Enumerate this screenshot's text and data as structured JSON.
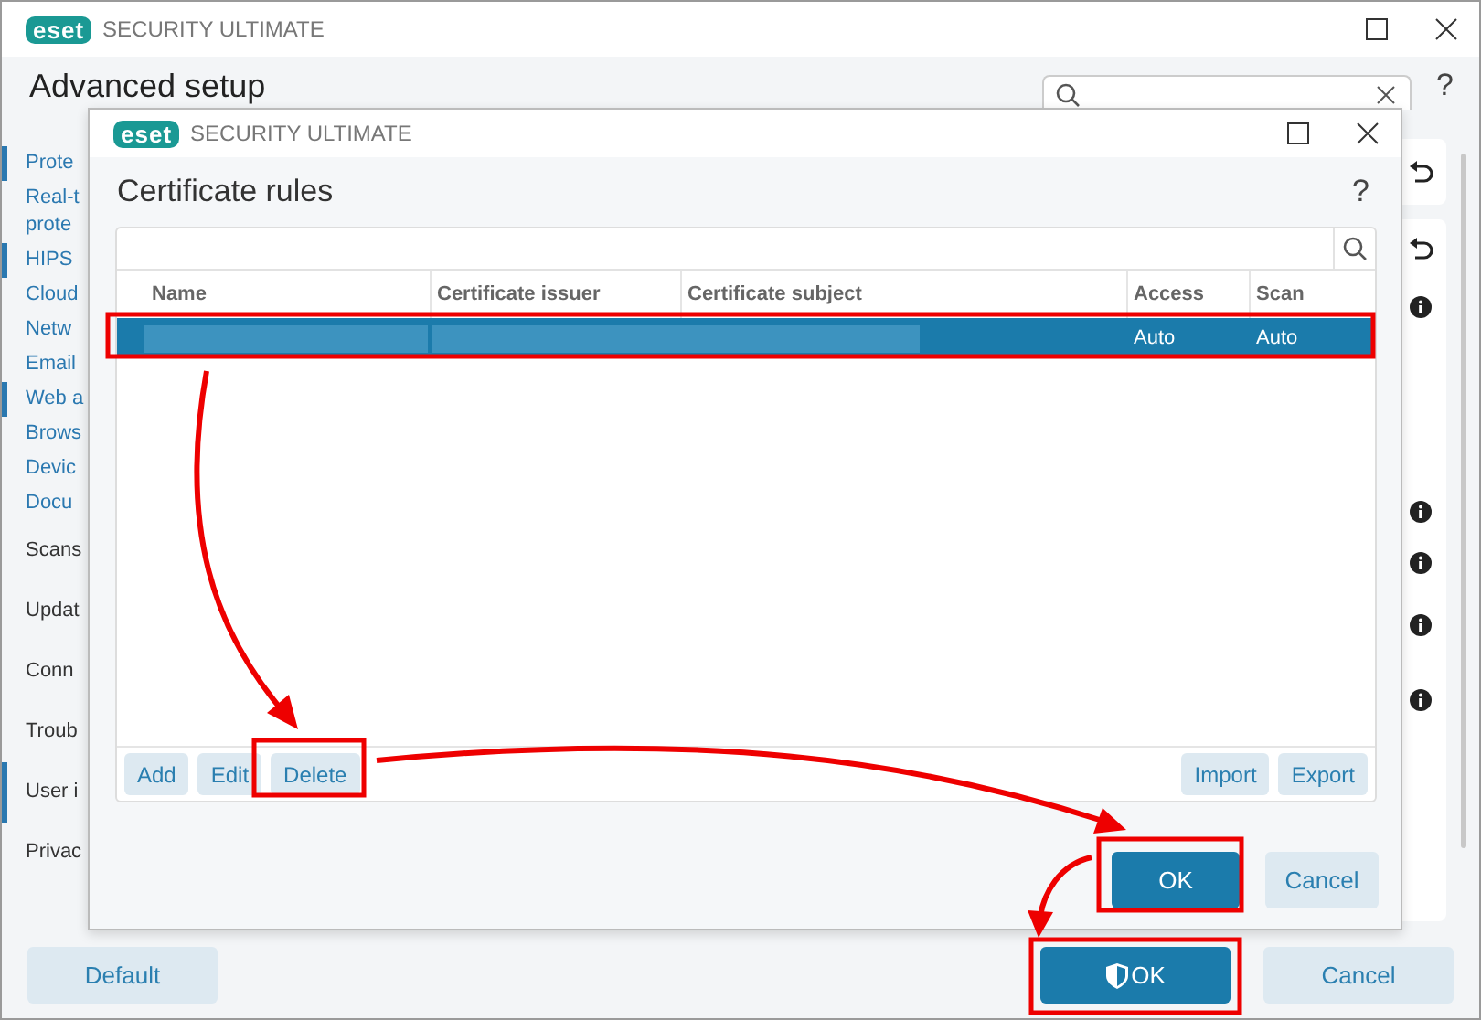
{
  "window": {
    "logo": "eset",
    "title": "SECURITY ULTIMATE"
  },
  "page": {
    "title": "Advanced setup",
    "help": "?"
  },
  "sidebar": {
    "items": [
      {
        "label": "Prote",
        "kind": "link",
        "modified": true
      },
      {
        "label": "Real-t\nprote",
        "kind": "link",
        "modified": false
      },
      {
        "label": "HIPS",
        "kind": "link",
        "modified": true
      },
      {
        "label": "Cloud",
        "kind": "link",
        "modified": false
      },
      {
        "label": "Netw",
        "kind": "link",
        "modified": false
      },
      {
        "label": "Email",
        "kind": "link",
        "modified": false
      },
      {
        "label": "Web a",
        "kind": "link",
        "modified": true
      },
      {
        "label": "Brows",
        "kind": "link",
        "modified": false
      },
      {
        "label": "Devic",
        "kind": "link",
        "modified": false
      },
      {
        "label": "Docu",
        "kind": "link",
        "modified": false
      },
      {
        "label": "Scans",
        "kind": "category",
        "modified": false
      },
      {
        "label": "Updat",
        "kind": "category",
        "modified": false
      },
      {
        "label": "Conn",
        "kind": "category",
        "modified": false
      },
      {
        "label": "Troub",
        "kind": "category",
        "modified": false
      },
      {
        "label": "User i",
        "kind": "category",
        "modified": true
      },
      {
        "label": "Privac",
        "kind": "category",
        "modified": false
      }
    ]
  },
  "dialog": {
    "logo": "eset",
    "title": "SECURITY ULTIMATE",
    "heading": "Certificate rules",
    "help": "?",
    "table": {
      "columns": [
        "Name",
        "Certificate issuer",
        "Certificate subject",
        "Access",
        "Scan"
      ],
      "rows": [
        {
          "selected": true,
          "access": "Auto",
          "scan": "Auto"
        }
      ]
    },
    "table_buttons_left": [
      "Add",
      "Edit",
      "Delete"
    ],
    "table_buttons_right": [
      "Import",
      "Export"
    ],
    "buttons": [
      {
        "label": "OK",
        "kind": "primary"
      },
      {
        "label": "Cancel",
        "kind": "secondary"
      }
    ]
  },
  "footer": {
    "buttons": [
      {
        "label": "Default",
        "kind": "secondary"
      },
      {
        "label": "OK",
        "kind": "primary"
      },
      {
        "label": "Cancel",
        "kind": "secondary"
      }
    ]
  }
}
